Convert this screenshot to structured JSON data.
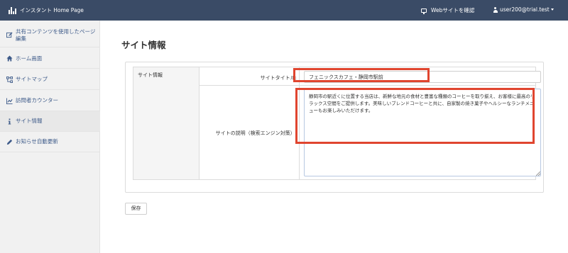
{
  "header": {
    "brand": "インスタント Home Page",
    "view_site_link": "Webサイトを確認",
    "user_menu": "user200@trial.test"
  },
  "sidebar": {
    "items": [
      {
        "label": "共有コンテンツを使用したページ編集",
        "icon": "edit-icon"
      },
      {
        "label": "ホーム画面",
        "icon": "home-icon"
      },
      {
        "label": "サイトマップ",
        "icon": "sitemap-icon"
      },
      {
        "label": "訪問者カウンター",
        "icon": "chart-icon"
      },
      {
        "label": "サイト情報",
        "icon": "info-icon",
        "active": true
      },
      {
        "label": "お知らせ自動更新",
        "icon": "pencil-icon"
      }
    ]
  },
  "main": {
    "title": "サイト情報",
    "section_label": "サイト情報",
    "site_title_label": "サイトタイトル:",
    "site_title_value": "フェニックスカフェ・静岡市駅前",
    "description_label": "サイトの説明（検索エンジン対策）:",
    "description_value": "静岡市の駅近くに位置する当店は、新鮮な地元の食材と豊富な種類のコーヒーを取り揃え、お客様に最高のリラックス空間をご提供します。美味しいブレンドコーヒーと共に、自家製の焼き菓子やヘルシーなランチメニューもお楽しみいただけます。",
    "save_button": "保存"
  },
  "colors": {
    "topbar": "#3a4b66",
    "sidebar_bg": "#f1f1f1",
    "link": "#3d5a89",
    "highlight": "#e0452f"
  }
}
